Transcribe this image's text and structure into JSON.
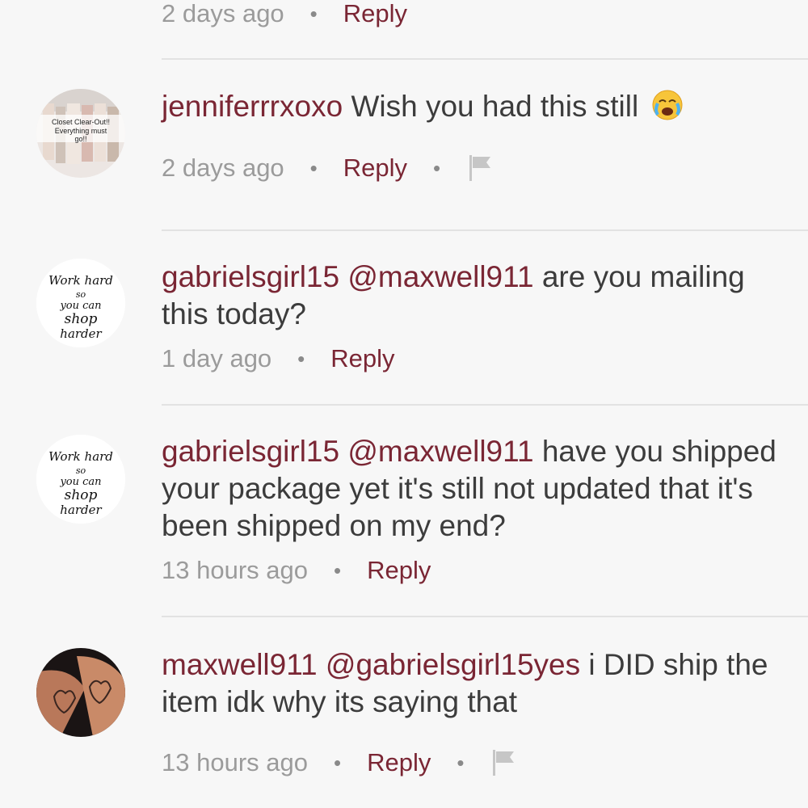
{
  "comments": [
    {
      "timestamp": "2 days ago",
      "reply_label": "Reply"
    },
    {
      "username": "jenniferrrxoxo",
      "text": "Wish you had this still",
      "emoji": "crying-face-icon",
      "timestamp": "2 days ago",
      "reply_label": "Reply",
      "avatar_text": "Closet Clear-Out!! Everything must go!!"
    },
    {
      "username": "gabrielsgirl15",
      "mention": "@maxwell911",
      "text": "are you mailing this today?",
      "timestamp": "1 day ago",
      "reply_label": "Reply",
      "avatar_text": "Work hard so you can shop harder"
    },
    {
      "username": "gabrielsgirl15",
      "mention": "@maxwell911",
      "text": "have you shipped your package yet it's still not updated that it's been shipped on my end?",
      "timestamp": "13 hours ago",
      "reply_label": "Reply",
      "avatar_text": "Work hard so you can shop harder"
    },
    {
      "username": "maxwell911",
      "mention": "@gabrielsgirl15yes",
      "text": "i DID ship the item idk why its saying that",
      "timestamp": "13 hours ago",
      "reply_label": "Reply"
    }
  ],
  "colors": {
    "accent": "#7a2634",
    "text": "#3c3c3c",
    "muted": "#9b9b9b",
    "divider": "#e2e2e2",
    "background": "#f7f7f7"
  }
}
